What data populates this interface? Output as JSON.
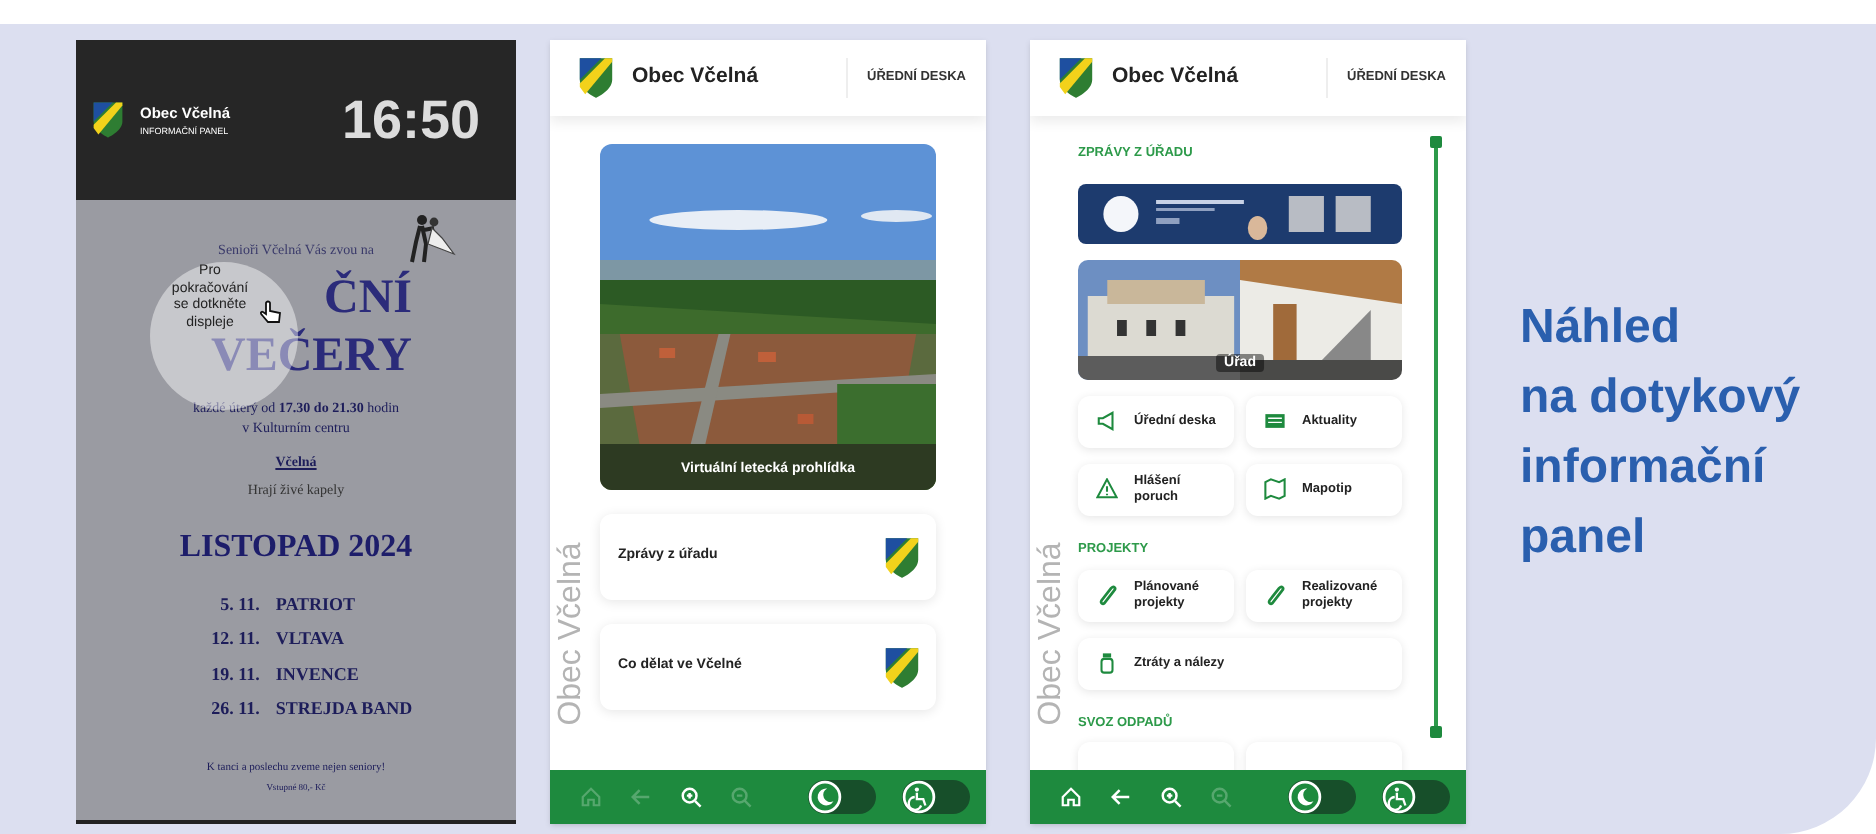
{
  "idle_screen": {
    "municipality": "Obec Včelná",
    "subtitle": "INFORMAČNÍ PANEL",
    "time": "16:50",
    "poster": {
      "intro": "Senioři Včelná Vás zvou na",
      "title_lines": [
        "ČNÍ",
        "VEČERY"
      ],
      "schedule": "každé úterý od **17.30 do 21.30** hodin",
      "venue": "v Kulturním centru",
      "place": "Včelná",
      "bands_note": "Hrají živé kapely",
      "month": "LISTOPAD 2024",
      "events": [
        {
          "date": "5. 11.",
          "band": "PATRIOT"
        },
        {
          "date": "12. 11.",
          "band": "VLTAVA"
        },
        {
          "date": "19. 11.",
          "band": "INVENCE"
        },
        {
          "date": "26. 11.",
          "band": "STREJDA BAND"
        }
      ],
      "footer": "K tanci a poslechu zveme nejen seniory!",
      "admission": "Vstupné 80,- Kč"
    },
    "overlay_text": "Pro pokračování se dotkněte displeje"
  },
  "home_screen": {
    "title": "Obec Včelná",
    "header_link": "ÚŘEDNÍ DESKA",
    "side_text": "Obec Včelná",
    "feature": {
      "kind": "picture",
      "caption": "Virtuální letecká prohlídka"
    },
    "cards": [
      {
        "label": "Zprávy z úřadu"
      },
      {
        "label": "Co dělat ve Včelné"
      }
    ],
    "toolbar": [
      {
        "kind": "home",
        "disabled": true
      },
      {
        "kind": "back",
        "disabled": true
      },
      {
        "kind": "zoom_in",
        "disabled": false
      },
      {
        "kind": "zoom_out",
        "disabled": true
      }
    ],
    "toggles": [
      {
        "kind": "night",
        "on": false
      },
      {
        "kind": "accessibility",
        "on": false
      }
    ]
  },
  "office_screen": {
    "title": "Obec Včelná",
    "header_link": "ÚŘEDNÍ DESKA",
    "side_text": "Obec Včelná",
    "sections": [
      {
        "title": "ZPRÁVY Z ÚŘADU",
        "items": [
          {
            "kind": "banner"
          },
          {
            "caption": "Úřad"
          },
          {
            "kind": "tile",
            "label": "Úřední deska"
          },
          {
            "kind": "tile",
            "label": "Aktuality"
          },
          {
            "kind": "tile",
            "label": "Hlášení\nporuch"
          },
          {
            "kind": "tile",
            "label": "Mapotip"
          }
        ]
      },
      {
        "title": "PROJEKTY",
        "items": [
          {
            "kind": "tile",
            "label": "Plánované\nprojekty"
          },
          {
            "kind": "tile",
            "label": "Realizované\nprojekty"
          },
          {
            "kind": "wide_tile",
            "label": "Ztráty a nálezy"
          }
        ]
      },
      {
        "title": "SVOZ ODPADŮ",
        "items": [
          {
            "kind": "card"
          },
          {
            "kind": "card"
          }
        ]
      }
    ],
    "toolbar": [
      {
        "kind": "home",
        "disabled": false
      },
      {
        "kind": "back",
        "disabled": false
      },
      {
        "kind": "zoom_in",
        "disabled": false
      },
      {
        "kind": "zoom_out",
        "disabled": true
      }
    ],
    "toggles": [
      {
        "kind": "night",
        "on": false
      },
      {
        "kind": "accessibility",
        "on": false
      }
    ]
  },
  "headline": "Náhled\nna dotykový\ninformační\npanel"
}
